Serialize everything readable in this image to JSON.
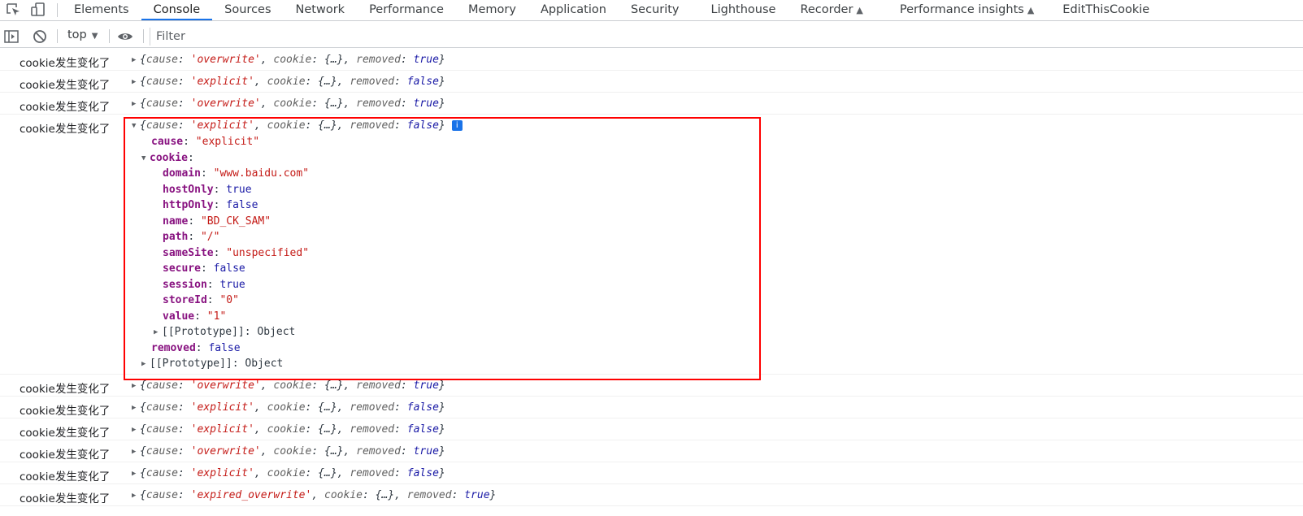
{
  "tabs": [
    {
      "label": "Elements"
    },
    {
      "label": "Console"
    },
    {
      "label": "Sources"
    },
    {
      "label": "Network"
    },
    {
      "label": "Performance"
    },
    {
      "label": "Memory"
    },
    {
      "label": "Application"
    },
    {
      "label": "Security"
    },
    {
      "label": "Lighthouse"
    },
    {
      "label": "Recorder"
    },
    {
      "label": "Performance insights"
    },
    {
      "label": "EditThisCookie"
    }
  ],
  "active_tab": "Console",
  "toolbar": {
    "context": "top",
    "filter_placeholder": "Filter"
  },
  "message_prefix": "cookie发生变化了",
  "logs": [
    {
      "cause": "'overwrite'",
      "removed": "true"
    },
    {
      "cause": "'explicit'",
      "removed": "false"
    },
    {
      "cause": "'overwrite'",
      "removed": "true"
    },
    {
      "cause": "'explicit'",
      "removed": "false",
      "expanded": true
    },
    {
      "cause": "'overwrite'",
      "removed": "true"
    },
    {
      "cause": "'explicit'",
      "removed": "false"
    },
    {
      "cause": "'explicit'",
      "removed": "false"
    },
    {
      "cause": "'overwrite'",
      "removed": "true"
    },
    {
      "cause": "'explicit'",
      "removed": "false"
    },
    {
      "cause": "'expired_overwrite'",
      "removed": "true"
    }
  ],
  "labels": {
    "cause": "cause",
    "cookie": "cookie",
    "removed": "removed",
    "ellipsis_obj": "{…}",
    "prototype": "[[Prototype]]",
    "object": "Object"
  },
  "expanded_object": {
    "cause": "\"explicit\"",
    "cookie": {
      "domain": "\"www.baidu.com\"",
      "hostOnly": "true",
      "httpOnly": "false",
      "name": "\"BD_CK_SAM\"",
      "path": "\"/\"",
      "sameSite": "\"unspecified\"",
      "secure": "false",
      "session": "true",
      "storeId": "\"0\"",
      "value": "\"1\""
    },
    "removed": "false"
  },
  "colors": {
    "accent": "#1a73e8",
    "highlight_box": "#ff0000",
    "string": "#c41a16",
    "keyword": "#1a1aa6",
    "property": "#881280"
  }
}
